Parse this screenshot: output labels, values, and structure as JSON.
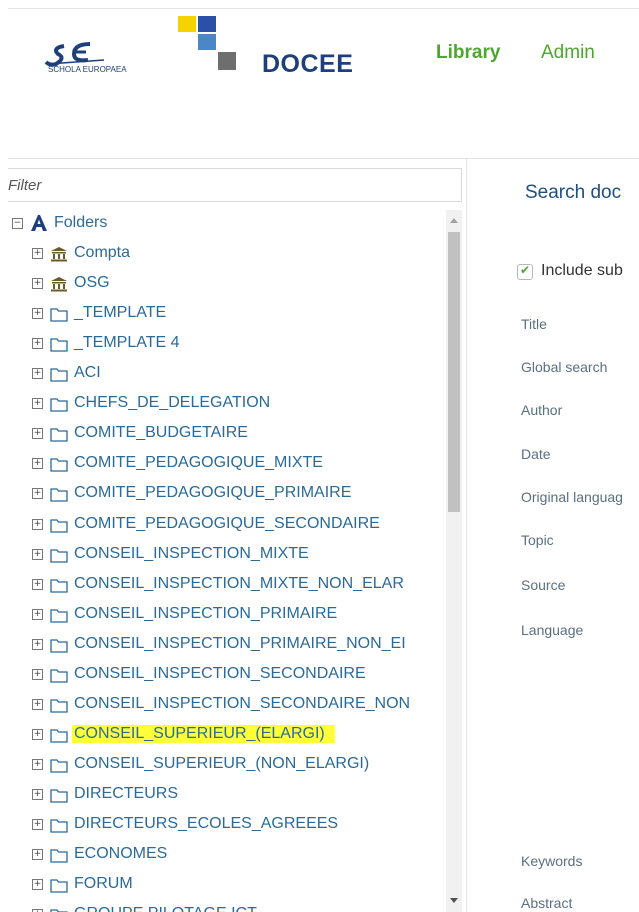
{
  "header": {
    "brand_title": "DOCEE",
    "nav": {
      "library": "Library",
      "admin": "Admin"
    },
    "schola_logo_text": "SCHOLA EUROPAEA"
  },
  "left": {
    "filter_placeholder": "Filter",
    "tree": {
      "root_label": "Folders",
      "items": [
        {
          "label": "Compta",
          "icon": "institution-icon"
        },
        {
          "label": "OSG",
          "icon": "institution-icon"
        },
        {
          "label": "_TEMPLATE",
          "icon": "folder-icon"
        },
        {
          "label": "_TEMPLATE 4",
          "icon": "folder-icon"
        },
        {
          "label": "ACI",
          "icon": "folder-icon"
        },
        {
          "label": "CHEFS_DE_DELEGATION",
          "icon": "folder-icon"
        },
        {
          "label": "COMITE_BUDGETAIRE",
          "icon": "folder-icon"
        },
        {
          "label": "COMITE_PEDAGOGIQUE_MIXTE",
          "icon": "folder-icon"
        },
        {
          "label": "COMITE_PEDAGOGIQUE_PRIMAIRE",
          "icon": "folder-icon"
        },
        {
          "label": "COMITE_PEDAGOGIQUE_SECONDAIRE",
          "icon": "folder-icon"
        },
        {
          "label": "CONSEIL_INSPECTION_MIXTE",
          "icon": "folder-icon"
        },
        {
          "label": "CONSEIL_INSPECTION_MIXTE_NON_ELAR",
          "icon": "folder-icon"
        },
        {
          "label": "CONSEIL_INSPECTION_PRIMAIRE",
          "icon": "folder-icon"
        },
        {
          "label": "CONSEIL_INSPECTION_PRIMAIRE_NON_EI",
          "icon": "folder-icon"
        },
        {
          "label": "CONSEIL_INSPECTION_SECONDAIRE",
          "icon": "folder-icon"
        },
        {
          "label": "CONSEIL_INSPECTION_SECONDAIRE_NON",
          "icon": "folder-icon"
        },
        {
          "label": "CONSEIL_SUPERIEUR_(ELARGI)",
          "icon": "folder-icon",
          "highlighted": true
        },
        {
          "label": "CONSEIL_SUPERIEUR_(NON_ELARGI)",
          "icon": "folder-icon"
        },
        {
          "label": "DIRECTEURS",
          "icon": "folder-icon"
        },
        {
          "label": "DIRECTEURS_ECOLES_AGREEES",
          "icon": "folder-icon"
        },
        {
          "label": "ECONOMES",
          "icon": "folder-icon"
        },
        {
          "label": "FORUM",
          "icon": "folder-icon"
        },
        {
          "label": "GROUPE PILOTAGE ICT",
          "icon": "folder-icon"
        }
      ]
    }
  },
  "right": {
    "search_title": "Search doc",
    "include_label": "Include sub",
    "include_checked": true,
    "fields": [
      "Title",
      "Global search",
      "Author",
      "Date",
      "Original languag",
      "Topic",
      "Source",
      "Language",
      "Keywords",
      "Abstract"
    ]
  },
  "colors": {
    "accent_green": "#4fa62e",
    "tree_text": "#2a6a9a",
    "highlight": "#ffff3a",
    "brand_navy": "#1f3f7a"
  }
}
